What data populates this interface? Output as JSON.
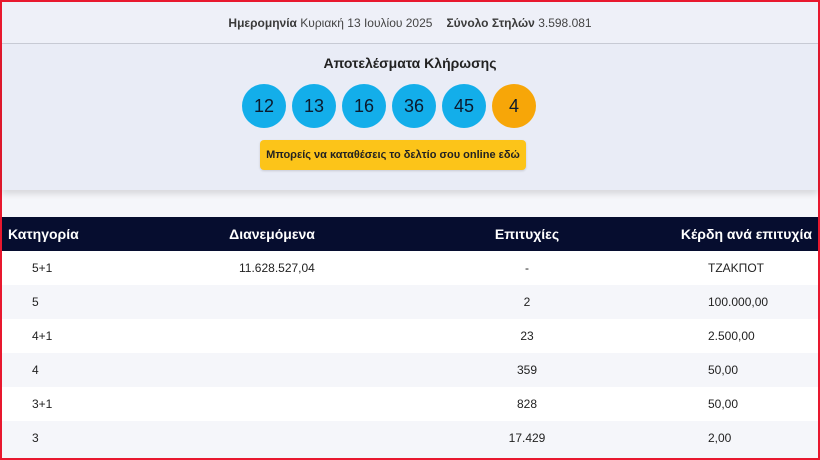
{
  "header": {
    "date_label": "Ημερομηνία",
    "date_value": "Κυριακή 13 Ιουλίου 2025",
    "columns_label": "Σύνολο Στηλών",
    "columns_value": "3.598.081"
  },
  "results": {
    "title": "Αποτελέσματα Κλήρωσης",
    "numbers": [
      "12",
      "13",
      "16",
      "36",
      "45"
    ],
    "bonus": "4",
    "cta_label": "Μπορείς να καταθέσεις το δελτίο σου online εδώ",
    "colors": {
      "main_ball": "#13aeea",
      "bonus_ball": "#f7a608",
      "cta": "#fcc419"
    }
  },
  "table": {
    "headers": [
      "Κατηγορία",
      "Διανεμόμενα",
      "Επιτυχίες",
      "Κέρδη ανά επιτυχία"
    ],
    "rows": [
      [
        "5+1",
        "11.628.527,04",
        "-",
        "ΤΖΑΚΠΟΤ"
      ],
      [
        "5",
        "",
        "2",
        "100.000,00"
      ],
      [
        "4+1",
        "",
        "23",
        "2.500,00"
      ],
      [
        "4",
        "",
        "359",
        "50,00"
      ],
      [
        "3+1",
        "",
        "828",
        "50,00"
      ],
      [
        "3",
        "",
        "17.429",
        "2,00"
      ]
    ],
    "header_color": "#060d2f"
  }
}
